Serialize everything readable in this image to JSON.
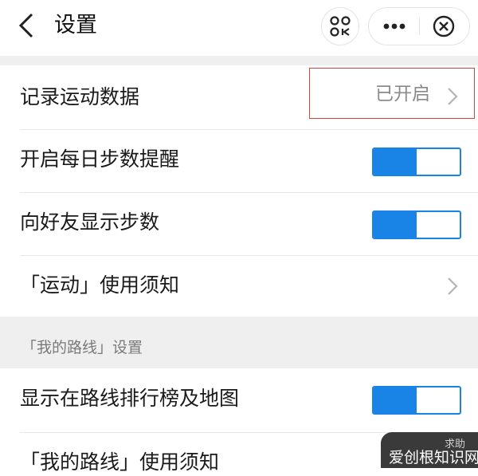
{
  "header": {
    "title": "设置",
    "back_icon": "chevron-left-icon",
    "scan_icon": "scan-icon",
    "more_icon": "more-dots-icon",
    "close_icon": "close-circle-icon"
  },
  "settings": {
    "record_data": {
      "label": "记录运动数据",
      "status": "已开启"
    },
    "daily_reminder": {
      "label": "开启每日步数提醒",
      "enabled": true
    },
    "show_friends": {
      "label": "向好友显示步数",
      "enabled": true
    },
    "sport_notice": {
      "label": "「运动」使用须知"
    }
  },
  "route_section": {
    "title": "「我的路线」设置",
    "show_on_leaderboard": {
      "label": "显示在路线排行榜及地图",
      "enabled": true
    },
    "route_notice": {
      "label": "「我的路线」使用须知"
    }
  },
  "overlay": {
    "help_text": "求助",
    "watermark_text": "爱创根知识网"
  },
  "colors": {
    "accent": "#1a84e6",
    "highlight": "#c9483c",
    "band": "#efefef"
  }
}
